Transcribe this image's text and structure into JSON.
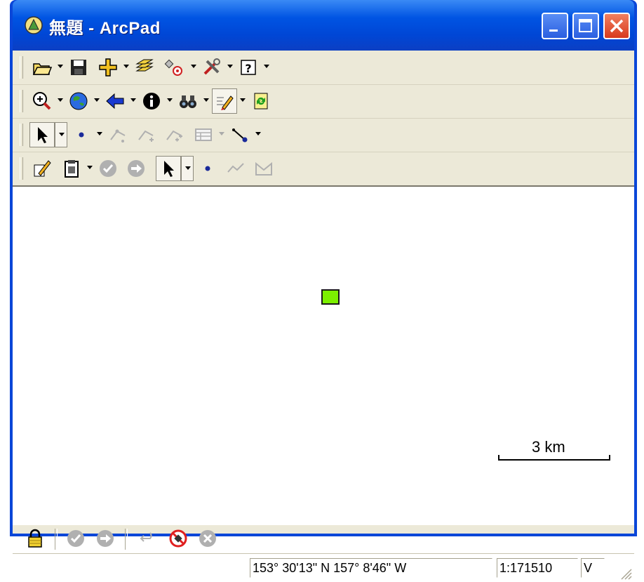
{
  "window": {
    "title": "無題 - ArcPad"
  },
  "toolbars": {
    "row1": [
      "open-icon",
      "save-icon",
      "add-layer-icon",
      "layers-icon",
      "gps-icon",
      "tools-icon",
      "help-icon"
    ],
    "row2": [
      "zoom-in-icon",
      "globe-icon",
      "back-icon",
      "info-icon",
      "find-icon",
      "edit-pencil-icon",
      "refresh-icon"
    ],
    "row3": [
      "select-arrow-icon",
      "point-icon",
      "vertex-icon",
      "add-vertex-icon",
      "add-vertices-icon",
      "table-icon",
      "line-point-icon"
    ],
    "row4": [
      "edit-form-icon",
      "clipboard-icon",
      "check-icon",
      "forward-icon",
      "select-arrow-icon",
      "point-icon",
      "polyline-icon",
      "polygon-icon"
    ]
  },
  "map": {
    "scale_bar_label": "3 km",
    "feature_color": "#7cf000"
  },
  "edit_toolbar": [
    "lock-icon",
    "check-icon",
    "forward-icon",
    "undo-icon",
    "no-gps-icon",
    "cancel-icon"
  ],
  "status_bar": {
    "coordinates": "153°  30'13\" N 157°  8'46\" W",
    "scale": "1:171510",
    "mode": "V"
  },
  "colors": {
    "titlebar": "#0054e3",
    "face": "#ece9d8",
    "close_button": "#d83a1c"
  }
}
